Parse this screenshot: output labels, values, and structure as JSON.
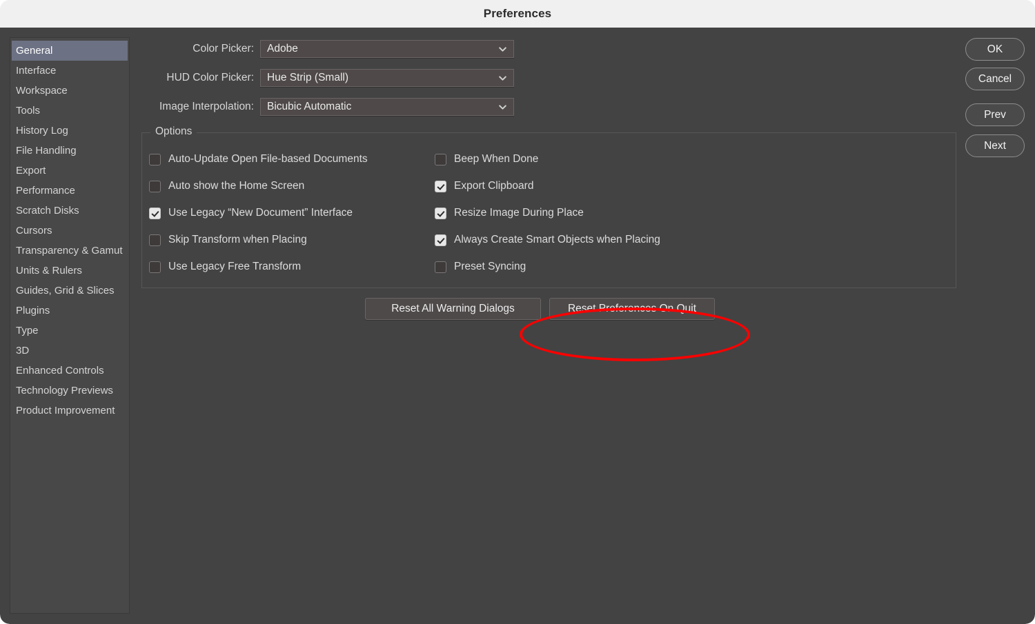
{
  "window": {
    "title": "Preferences"
  },
  "colors": {
    "titlebar_bg": "#f0f0f0",
    "dialog_bg": "#434343",
    "sidebar_bg": "#484848",
    "sidebar_selected_bg": "#6c7183",
    "text": "#dcdcdc",
    "annotation_red": "#fd0000"
  },
  "sidebar": {
    "selected": "General",
    "items": [
      {
        "label": "General"
      },
      {
        "label": "Interface"
      },
      {
        "label": "Workspace"
      },
      {
        "label": "Tools"
      },
      {
        "label": "History Log"
      },
      {
        "label": "File Handling"
      },
      {
        "label": "Export"
      },
      {
        "label": "Performance"
      },
      {
        "label": "Scratch Disks"
      },
      {
        "label": "Cursors"
      },
      {
        "label": "Transparency & Gamut"
      },
      {
        "label": "Units & Rulers"
      },
      {
        "label": "Guides, Grid & Slices"
      },
      {
        "label": "Plugins"
      },
      {
        "label": "Type"
      },
      {
        "label": "3D"
      },
      {
        "label": "Enhanced Controls"
      },
      {
        "label": "Technology Previews"
      },
      {
        "label": "Product Improvement"
      }
    ]
  },
  "fields": [
    {
      "label": "Color Picker:",
      "value": "Adobe"
    },
    {
      "label": "HUD Color Picker:",
      "value": "Hue Strip (Small)"
    },
    {
      "label": "Image Interpolation:",
      "value": "Bicubic Automatic"
    }
  ],
  "options": {
    "legend": "Options",
    "left_column": [
      {
        "label": "Auto-Update Open File-based Documents",
        "checked": false
      },
      {
        "label": "Auto show the Home Screen",
        "checked": false
      },
      {
        "label": "Use Legacy “New Document” Interface",
        "checked": true
      },
      {
        "label": "Skip Transform when Placing",
        "checked": false
      },
      {
        "label": "Use Legacy Free Transform",
        "checked": false
      }
    ],
    "right_column": [
      {
        "label": "Beep When Done",
        "checked": false
      },
      {
        "label": "Export Clipboard",
        "checked": true
      },
      {
        "label": "Resize Image During Place",
        "checked": true
      },
      {
        "label": "Always Create Smart Objects when Placing",
        "checked": true
      },
      {
        "label": "Preset Syncing",
        "checked": false
      }
    ]
  },
  "reset_buttons": [
    {
      "label": "Reset All Warning Dialogs"
    },
    {
      "label": "Reset Preferences On Quit"
    }
  ],
  "actions": [
    {
      "label": "OK"
    },
    {
      "label": "Cancel"
    },
    {
      "label": "Prev"
    },
    {
      "label": "Next"
    }
  ],
  "annotation": {
    "shape": "ellipse",
    "target": "Reset Preferences On Quit"
  }
}
